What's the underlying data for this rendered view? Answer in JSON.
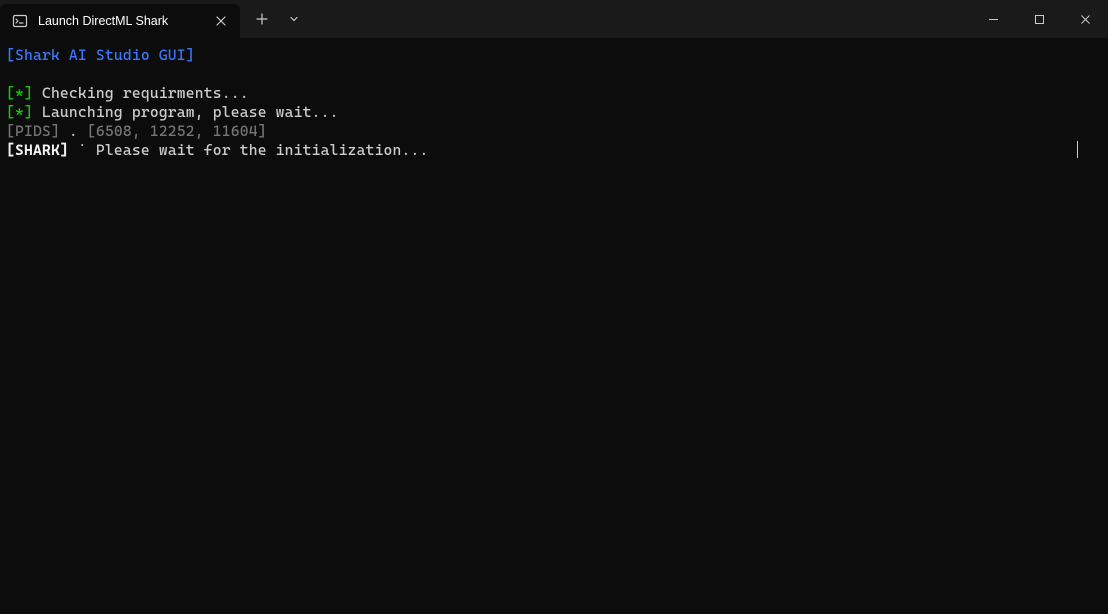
{
  "window": {
    "tab_title": "Launch DirectML Shark"
  },
  "terminal": {
    "header": "[Shark AI Studio GUI]",
    "lines": [
      {
        "prefix": "[*]",
        "text": " Checking requirments..."
      },
      {
        "prefix": "[*]",
        "text": " Launching program, please wait..."
      }
    ],
    "pids": {
      "label": "[PIDS]",
      "sep": " . ",
      "values": "[6508, 12252, 11604]"
    },
    "shark": {
      "label": "[SHARK]",
      "sep": " ˙ ",
      "text": "Please wait for the initialization..."
    }
  }
}
